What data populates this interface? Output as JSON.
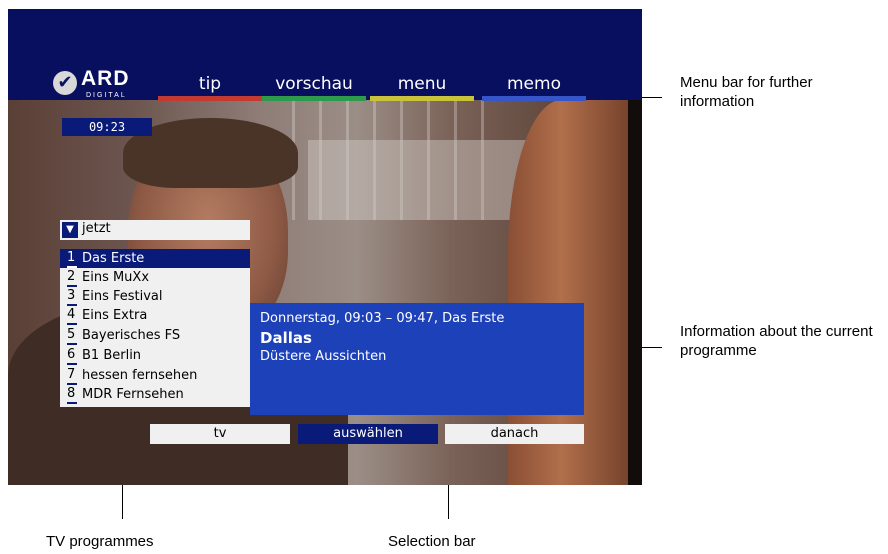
{
  "menu_bar": {
    "logo_text": "ARD",
    "logo_sub": "DIGITAL",
    "items": [
      {
        "label": "tip",
        "color": "#c23a32"
      },
      {
        "label": "vorschau",
        "color": "#2e9a4b"
      },
      {
        "label": "menu",
        "color": "#c9c33b"
      },
      {
        "label": "memo",
        "color": "#3555c8"
      }
    ]
  },
  "clock": "09:23",
  "channel_list": {
    "header": "jetzt",
    "selected_index": 0,
    "items": [
      {
        "num": "1",
        "name": "Das Erste"
      },
      {
        "num": "2",
        "name": "Eins MuXx"
      },
      {
        "num": "3",
        "name": "Eins Festival"
      },
      {
        "num": "4",
        "name": "Eins Extra"
      },
      {
        "num": "5",
        "name": "Bayerisches FS"
      },
      {
        "num": "6",
        "name": "B1 Berlin"
      },
      {
        "num": "7",
        "name": "hessen fernsehen"
      },
      {
        "num": "8",
        "name": "MDR Fernsehen"
      }
    ]
  },
  "programme_info": {
    "line1": "Donnerstag, 09:03 – 09:47,   Das Erste",
    "title": "Dallas",
    "subtitle": "Düstere Aussichten"
  },
  "selection_bar": {
    "tv": "tv",
    "select": "auswählen",
    "next": "danach"
  },
  "annotations": {
    "menu_bar": "Menu bar for further information",
    "programme": "Information about the current programme",
    "tv_programmes": "TV programmes",
    "selection_bar": "Selection bar"
  },
  "colors": {
    "panel_blue": "#1d41b8",
    "selection_navy": "#0a1a78",
    "menu_background": "#080f5f"
  }
}
